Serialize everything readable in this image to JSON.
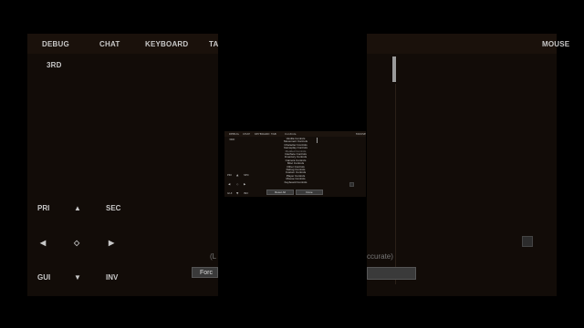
{
  "left_panel": {
    "tabs": [
      "DEBUG",
      "CHAT",
      "KEYBOARD",
      "TA"
    ],
    "mode": "3RD",
    "controls": {
      "pri": "PRI",
      "sec": "SEC",
      "gui": "GUI",
      "inv": "INV",
      "up": "▲",
      "down": "▼",
      "left": "◀",
      "right": "▶",
      "center": "◇"
    },
    "partial_text": "(L",
    "bottom_button": "Forc"
  },
  "right_panel": {
    "tab": "MOUSE",
    "partial_text": "ccurate)"
  },
  "center_screen": {
    "tabs": [
      "DEBUG",
      "CHAT",
      "KEYBOARD",
      "TAB"
    ],
    "mouse": "MOUSE",
    "mode": "3RD",
    "list_title": "Controls",
    "list_items": [
      "Vanilla Controls",
      "Movement Controls",
      "Character Controls",
      "Gameplay Controls",
      "Modded Controls",
      "Interface Controls",
      "Inventory Controls",
      "Camera Controls",
      "Misc Controls",
      "Other Controls",
      "Debug Controls",
      "Custom Controls",
      "Player Controls",
      "Mouse Controls",
      "Keyboard Controls"
    ],
    "bottom_buttons": [
      "Reset All",
      "Done"
    ]
  },
  "colors": {
    "panel": "#120c08",
    "bar": "#1a110b",
    "text": "#c8c8c8"
  }
}
